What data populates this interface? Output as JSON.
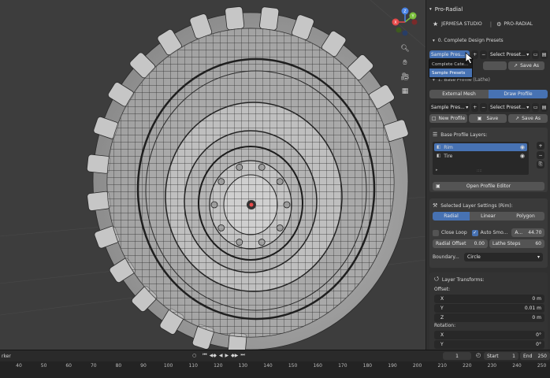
{
  "addon": {
    "title": "Pro-Radial",
    "studio": "JERMESA STUDIO",
    "product": "PRO-RADIAL"
  },
  "presets_section": {
    "title": "0. Complete Design Presets",
    "preset_select": "Sample Pres...",
    "preset_select_right": "Select Preset...",
    "save_as": "Save As"
  },
  "dropdown": {
    "items": [
      "Complete Cate...",
      "Sample Presets"
    ],
    "selected_index": 1
  },
  "base_profile_section": {
    "title": "1. Base Profile (Lathe)",
    "mode_tabs": [
      "External Mesh",
      "Draw Profile"
    ],
    "active_mode": 1,
    "preset_select": "Sample Pres...",
    "preset_select_right": "Select Preset...",
    "new_profile": "New Profile",
    "save": "Save",
    "save_as": "Save As"
  },
  "layers": {
    "title": "Base Profile Layers:",
    "items": [
      {
        "name": "Rim",
        "selected": true
      },
      {
        "name": "Tire",
        "selected": false
      }
    ],
    "editor_button": "Open Profile Editor"
  },
  "layer_settings": {
    "title": "Selected Layer Settings (Rim):",
    "tabs": [
      "Radial",
      "Linear",
      "Polygon"
    ],
    "active_tab": 0,
    "close_loop": "Close Loop",
    "close_loop_checked": false,
    "auto_smooth": "Auto Smo...",
    "auto_smooth_checked": true,
    "angle_label": "A...",
    "angle_value": "44.70",
    "radial_offset_label": "Radial Offset",
    "radial_offset_value": "0.00",
    "lathe_steps_label": "Lathe Steps",
    "lathe_steps_value": "60",
    "boundary_label": "Boundary...",
    "boundary_value": "Circle"
  },
  "transforms": {
    "title": "Layer Transforms:",
    "offset_label": "Offset:",
    "offset": [
      {
        "axis": "X",
        "value": "0 m"
      },
      {
        "axis": "Y",
        "value": "0.01 m"
      },
      {
        "axis": "Z",
        "value": "0 m"
      }
    ],
    "rotation_label": "Rotation:",
    "rotation": [
      {
        "axis": "X",
        "value": "0°"
      },
      {
        "axis": "Y",
        "value": "0°"
      }
    ]
  },
  "timeline": {
    "left_label": "rker",
    "ticks": [
      "40",
      "50",
      "60",
      "70",
      "80",
      "90",
      "100",
      "110",
      "120",
      "130",
      "140",
      "150",
      "160",
      "170",
      "180",
      "190",
      "200",
      "210",
      "220",
      "230",
      "240",
      "250"
    ],
    "current_frame": "1",
    "start_label": "Start",
    "start_value": "1",
    "end_label": "End",
    "end_value": "250"
  },
  "gizmo": {
    "axes": [
      "X",
      "Y",
      "Z"
    ],
    "axis_colors": {
      "x": "#e64a4a",
      "y": "#7bbf3c",
      "z": "#4a84e6"
    }
  },
  "colors": {
    "accent": "#4772b3",
    "panel_bg": "#303030",
    "viewport_bg": "#3d3d3d"
  }
}
